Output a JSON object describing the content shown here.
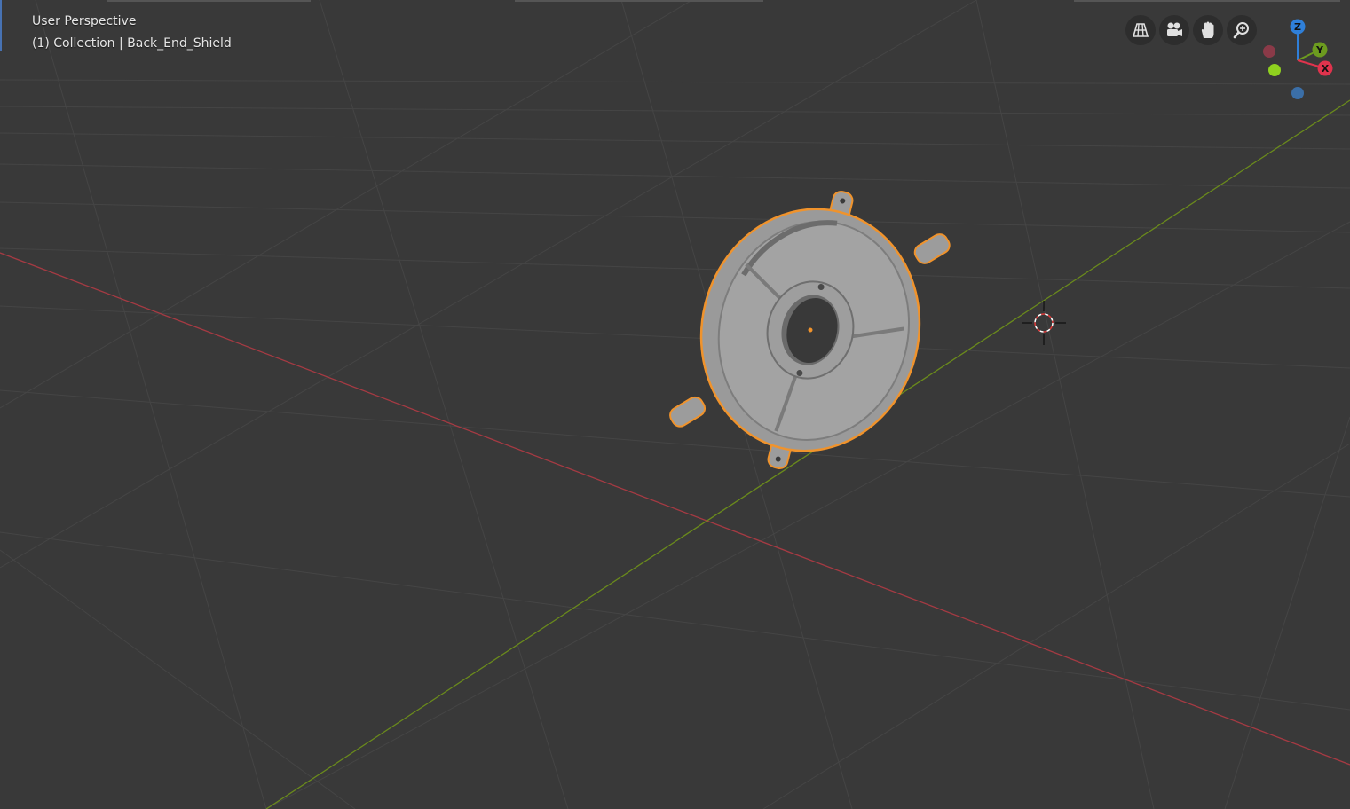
{
  "viewport": {
    "view_name": "User Perspective",
    "object_info": "(1) Collection | Back_End_Shield"
  },
  "navigation": {
    "buttons": [
      {
        "icon": "grid-icon",
        "title": "Toggle the camera view"
      },
      {
        "icon": "camera-icon",
        "title": "Switch to camera view"
      },
      {
        "icon": "hand-icon",
        "title": "Move the view"
      },
      {
        "icon": "zoom-icon",
        "title": "Zoom in/out in the view"
      }
    ]
  },
  "gizmo": {
    "axes": [
      {
        "label": "Z",
        "color": "#2f7fd8"
      },
      {
        "label": "Y",
        "color": "#6c9b1f"
      },
      {
        "label": "X",
        "color": "#e0334d"
      }
    ]
  },
  "colors": {
    "background": "#393939",
    "grid": "#444444",
    "x_axis": "#a53a43",
    "y_axis": "#6a8a1c",
    "selection_outline": "#f0932c",
    "mesh": "#9a9a9a"
  }
}
